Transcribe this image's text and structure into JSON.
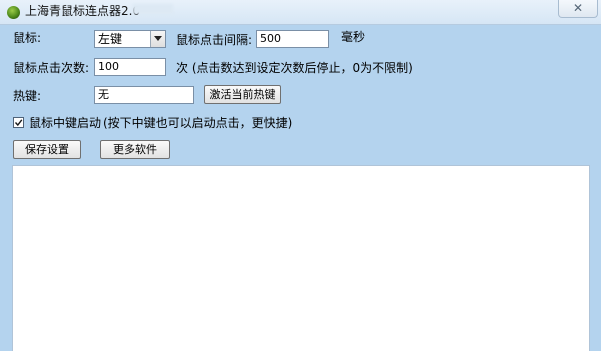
{
  "window": {
    "title": "上海青鼠标连点器2.0",
    "close_symbol": "✕"
  },
  "form": {
    "mouse_label": "鼠标:",
    "mouse_button": {
      "value": "左键"
    },
    "interval_label": "鼠标点击间隔:",
    "interval_value": "500",
    "interval_unit": "毫秒",
    "count_label": "鼠标点击次数:",
    "count_value": "100",
    "count_hint": "次 (点击数达到设定次数后停止，0为不限制)",
    "hotkey_label": "热键:",
    "hotkey_value": "无",
    "activate_hotkey_button": "激活当前热键",
    "middle_click": {
      "checked": true,
      "label": "鼠标中键启动",
      "hint": "(按下中键也可以启动点击，更快捷)"
    },
    "save_button": "保存设置",
    "more_button": "更多软件"
  },
  "log_area": {
    "text": ""
  }
}
